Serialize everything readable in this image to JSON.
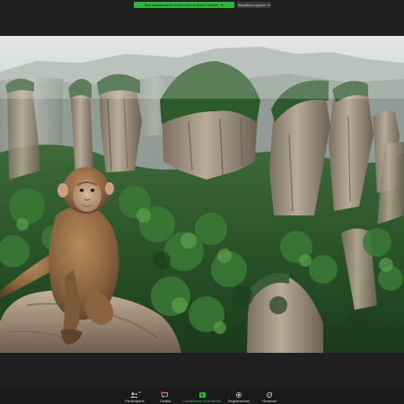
{
  "share_bar": {
    "status_text": "Stai visualizzando lo schermo di Marco Sanchi",
    "status_chevron": "chevron-down-icon",
    "view_options_label": "Visualizza opzioni",
    "view_options_chevron": "chevron-down-icon"
  },
  "shared_screen": {
    "content": "photo-monkey-on-rock-overlooking-karst-pillars"
  },
  "toolbar": {
    "participants": {
      "label": "Partecipanti",
      "count": "88",
      "icon": "participants-icon"
    },
    "chat": {
      "label": "Chatta",
      "icon": "chat-icon",
      "has_notification": true
    },
    "share": {
      "label": "Condividere lo schermo",
      "icon": "share-screen-icon",
      "color": "#2db53a"
    },
    "record": {
      "label": "Registrazione",
      "icon": "record-icon"
    },
    "reactions": {
      "label": "Reazioni",
      "icon": "reactions-icon"
    }
  },
  "colors": {
    "app_background": "#1f1f1f",
    "share_green": "#2db53a",
    "toolbar_background": "#1a1a1a",
    "notification_red": "#e0312b"
  }
}
